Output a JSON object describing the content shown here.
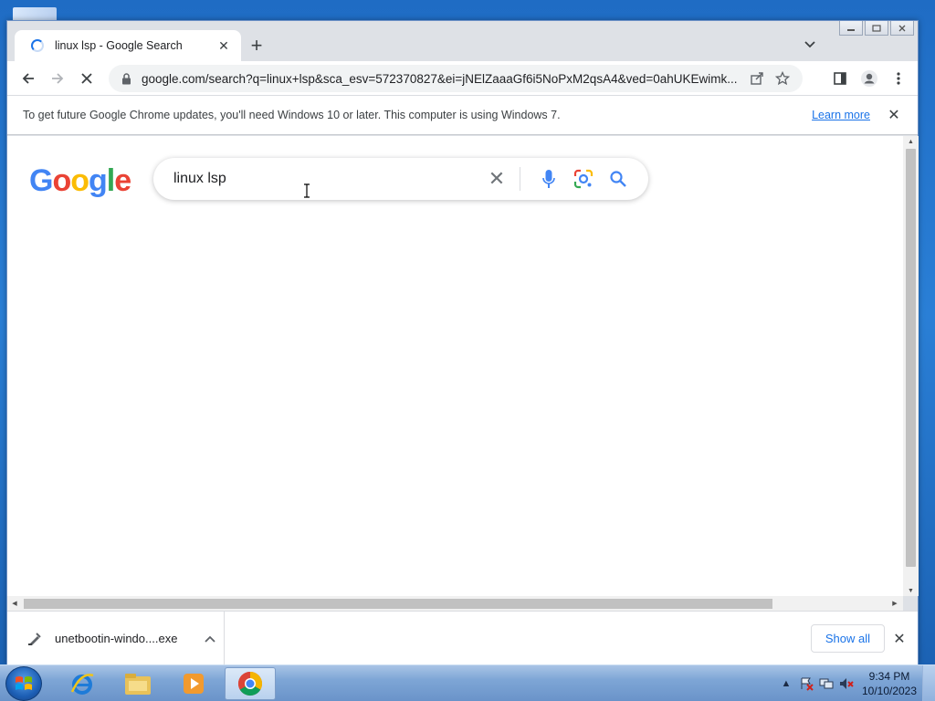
{
  "browser": {
    "tab": {
      "title": "linux lsp - Google Search",
      "close": "✕"
    },
    "new_tab": "+",
    "tab_search": "⌄",
    "url": "google.com/search?q=linux+lsp&sca_esv=572370827&ei=jNElZaaaGf6i5NoPxM2qsA4&ved=0ahUKEwimk..."
  },
  "infobar": {
    "message": "To get future Google Chrome updates, you'll need Windows 10 or later. This computer is using Windows 7.",
    "link": "Learn more",
    "close": "✕"
  },
  "page": {
    "logo": "Google",
    "search_value": "linux lsp",
    "clear": "✕"
  },
  "downloads": {
    "file": "unetbootin-windo....exe",
    "show_all": "Show all",
    "close": "✕"
  },
  "taskbar": {
    "time": "9:34 PM",
    "date": "10/10/2023"
  },
  "icons": {
    "back": "back-arrow-icon",
    "forward": "forward-arrow-icon",
    "stop": "stop-icon",
    "lock": "lock-icon",
    "share": "share-icon",
    "bookmark": "star-icon",
    "sidepanel": "side-panel-icon",
    "profile": "profile-icon",
    "menu": "kebab-menu-icon",
    "mic": "microphone-icon",
    "lens": "google-lens-icon",
    "search": "search-icon"
  }
}
